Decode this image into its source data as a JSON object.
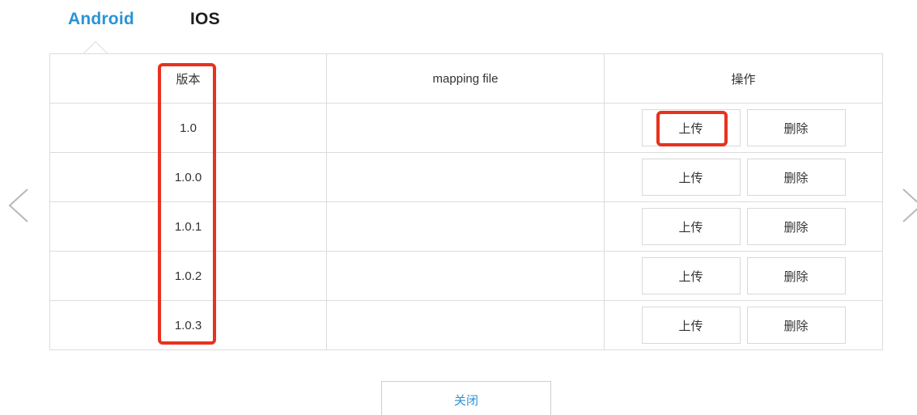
{
  "tabs": [
    {
      "label": "Android",
      "active": true
    },
    {
      "label": "IOS",
      "active": false
    }
  ],
  "table": {
    "headers": [
      "版本",
      "mapping file",
      "操作"
    ],
    "rows": [
      {
        "version": "1.0",
        "mapping_file": ""
      },
      {
        "version": "1.0.0",
        "mapping_file": ""
      },
      {
        "version": "1.0.1",
        "mapping_file": ""
      },
      {
        "version": "1.0.2",
        "mapping_file": ""
      },
      {
        "version": "1.0.3",
        "mapping_file": ""
      }
    ],
    "upload_label": "上传",
    "delete_label": "删除"
  },
  "footer": {
    "close_label": "关闭"
  },
  "icons": {
    "prev": "chevron-left-icon",
    "next": "chevron-right-icon"
  },
  "colors": {
    "accent": "#2b93d6",
    "highlight": "#e8321d",
    "border": "#dcdcdc"
  }
}
